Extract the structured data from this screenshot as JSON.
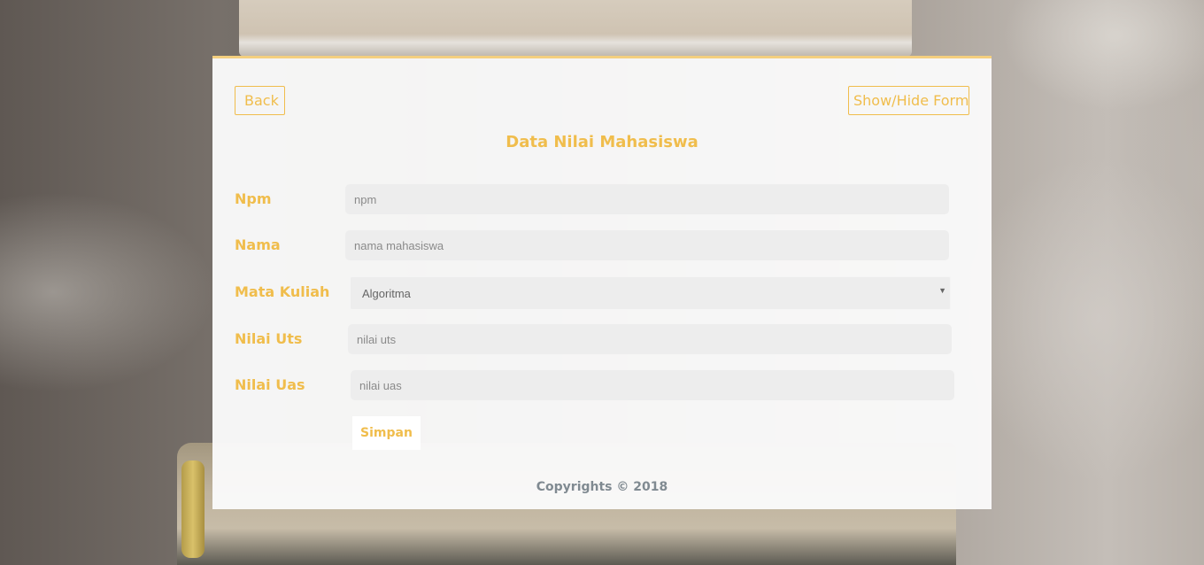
{
  "header": {
    "back_label": "Back",
    "toggle_label": "Show/Hide Form",
    "title": "Data Nilai Mahasiswa"
  },
  "form": {
    "npm": {
      "label": "Npm",
      "placeholder": "npm",
      "value": ""
    },
    "nama": {
      "label": "Nama",
      "placeholder": "nama mahasiswa",
      "value": ""
    },
    "mata_kuliah": {
      "label": "Mata Kuliah",
      "selected": "Algoritma"
    },
    "nilai_uts": {
      "label": "Nilai Uts",
      "placeholder": "nilai uts",
      "value": ""
    },
    "nilai_uas": {
      "label": "Nilai Uas",
      "placeholder": "nilai uas",
      "value": ""
    },
    "submit_label": "Simpan"
  },
  "footer": {
    "copyright": "Copyrights © 2018"
  },
  "colors": {
    "accent": "#f0bd4c",
    "field_bg": "#ededed",
    "footer_text": "#808a91"
  }
}
